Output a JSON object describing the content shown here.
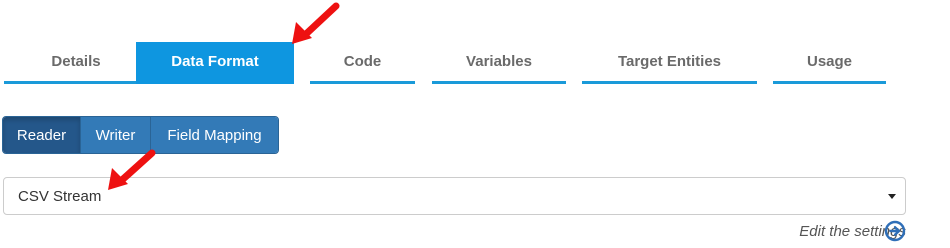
{
  "tabs": [
    {
      "label": "Details",
      "active": false
    },
    {
      "label": "Data Format",
      "active": true
    },
    {
      "label": "Code",
      "active": false
    },
    {
      "label": "Variables",
      "active": false
    },
    {
      "label": "Target Entities",
      "active": false
    },
    {
      "label": "Usage",
      "active": false
    }
  ],
  "subtabs": [
    {
      "label": "Reader",
      "active": true
    },
    {
      "label": "Writer",
      "active": false
    },
    {
      "label": "Field Mapping",
      "active": false
    }
  ],
  "reader_select": {
    "selected": "CSV Stream"
  },
  "edit_settings_label": "Edit the settings",
  "colors": {
    "tab_accent": "#0e96e0",
    "button_primary": "#337ab7",
    "button_active": "#24578a",
    "annotation_arrow": "#ee1111"
  },
  "icons": {
    "edit_settings": "circle-arrow-right-icon",
    "dropdown": "caret-down-icon",
    "annotation": "red-arrow-icon"
  }
}
